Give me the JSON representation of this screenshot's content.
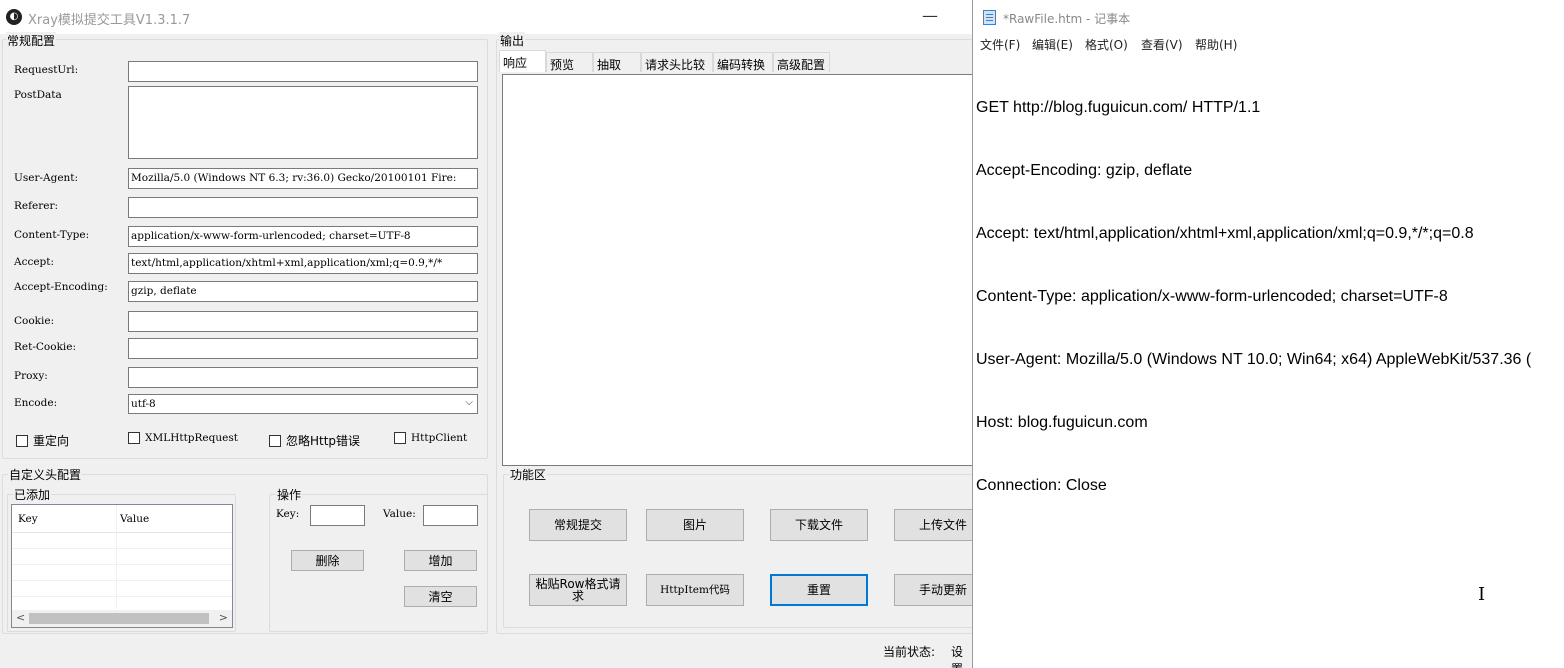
{
  "xray": {
    "title": "Xray模拟提交工具V1.3.1.7",
    "minimize_glyph": "—",
    "general_config": {
      "group_label": "常规配置",
      "fields": {
        "request_url": {
          "label": "RequestUrl:",
          "value": ""
        },
        "post_data": {
          "label": "PostData",
          "value": ""
        },
        "user_agent": {
          "label": "User-Agent:",
          "value": "Mozilla/5.0 (Windows NT 6.3; rv:36.0) Gecko/20100101 Fire:"
        },
        "referer": {
          "label": "Referer:",
          "value": ""
        },
        "content_type": {
          "label": "Content-Type:",
          "value": "application/x-www-form-urlencoded; charset=UTF-8"
        },
        "accept": {
          "label": "Accept:",
          "value": "text/html,application/xhtml+xml,application/xml;q=0.9,*/*"
        },
        "accept_encoding": {
          "label": "Accept-Encoding:",
          "value": "gzip, deflate"
        },
        "cookie": {
          "label": "Cookie:",
          "value": ""
        },
        "ret_cookie": {
          "label": "Ret-Cookie:",
          "value": ""
        },
        "proxy": {
          "label": "Proxy:",
          "value": ""
        },
        "encode": {
          "label": "Encode:",
          "value": "utf-8"
        }
      },
      "checkboxes": {
        "redirect": {
          "label": "重定向",
          "checked": false
        },
        "xmlhttprequest": {
          "label": "XMLHttpRequest",
          "checked": false
        },
        "ignore_http_error": {
          "label": "忽略Http错误",
          "checked": false
        },
        "httpclient": {
          "label": "HttpClient",
          "checked": false
        }
      }
    },
    "custom_headers": {
      "group_label": "自定义头配置",
      "added": {
        "group_label": "已添加",
        "columns": [
          "Key",
          "Value"
        ],
        "rows": []
      },
      "operations": {
        "group_label": "操作",
        "key_label": "Key:",
        "key_value": "",
        "value_label": "Value:",
        "value_value": "",
        "delete_label": "删除",
        "add_label": "增加",
        "clear_label": "清空"
      }
    },
    "output": {
      "group_label": "输出",
      "tabs": [
        "响应",
        "预览",
        "抽取",
        "请求头比较",
        "编码转换",
        "高级配置"
      ],
      "active_tab": "响应",
      "content": ""
    },
    "function_area": {
      "group_label": "功能区",
      "buttons": {
        "normal_submit": "常规提交",
        "image": "图片",
        "download_file": "下载文件",
        "upload_file": "上传文件",
        "paste_raw": "粘贴Row格式请求",
        "httpitem_code": "HttpItem代码",
        "reset": "重置",
        "manual_update": "手动更新"
      }
    },
    "status_bar": {
      "label": "当前状态:",
      "value": "设置"
    }
  },
  "notepad": {
    "title": "*RawFile.htm - 记事本",
    "menu": [
      "文件(F)",
      "编辑(E)",
      "格式(O)",
      "查看(V)",
      "帮助(H)"
    ],
    "content_lines": [
      "GET http://blog.fuguicun.com/ HTTP/1.1",
      "Accept-Encoding: gzip, deflate",
      "Accept: text/html,application/xhtml+xml,application/xml;q=0.9,*/*;q=0.8",
      "Content-Type: application/x-www-form-urlencoded; charset=UTF-8",
      "User-Agent: Mozilla/5.0 (Windows NT 10.0; Win64; x64) AppleWebKit/537.36 (",
      "Host: blog.fuguicun.com",
      "Connection: Close"
    ]
  }
}
